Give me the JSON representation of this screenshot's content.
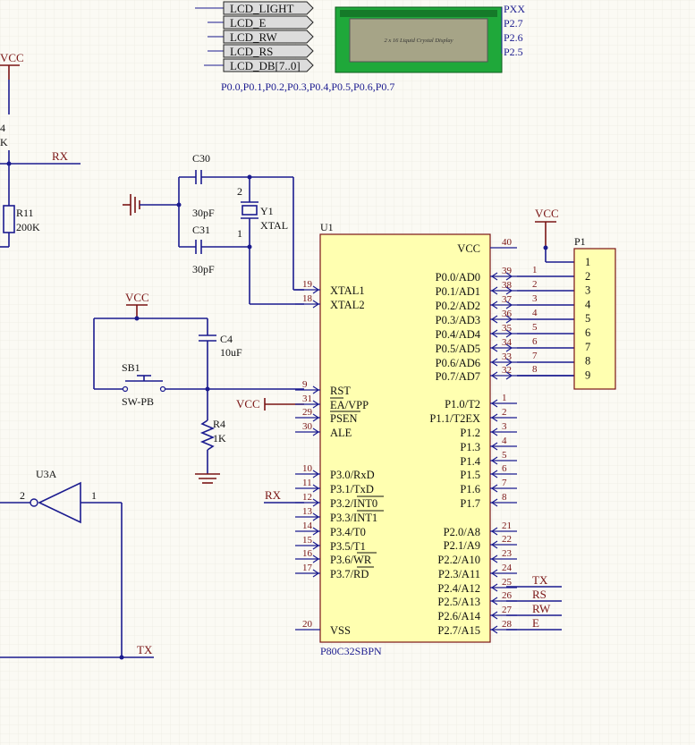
{
  "ports": [
    "LCD_LIGHT",
    "LCD_E",
    "LCD_RW",
    "LCD_RS",
    "LCD_DB[7..0]"
  ],
  "lcd": {
    "text": "2 x 16 Liquid Crystal Display",
    "pins": [
      "PXX",
      "P2.7",
      "P2.6",
      "P2.5"
    ],
    "bus_label": "P0.0,P0.1,P0.2,P0.3,P0.4,P0.5,P0.6,P0.7"
  },
  "power": {
    "vcc": "VCC"
  },
  "nets": {
    "rx": "RX",
    "tx": "TX",
    "rs": "RS",
    "rw": "RW",
    "e": "E"
  },
  "partial_resistor": {
    "line1": "4",
    "line2": "K"
  },
  "r11": {
    "ref": "R11",
    "value": "200K"
  },
  "c30": {
    "ref": "C30",
    "value": "30pF"
  },
  "c31": {
    "ref": "C31",
    "value": "30pF"
  },
  "y1": {
    "ref": "Y1",
    "value": "XTAL",
    "pin1": "1",
    "pin2": "2"
  },
  "c4": {
    "ref": "C4",
    "value": "10uF"
  },
  "sb1": {
    "ref": "SB1",
    "value": "SW-PB"
  },
  "r4": {
    "ref": "R4",
    "value": "1K"
  },
  "u3a": {
    "ref": "U3A",
    "pin_in": "1",
    "pin_out": "2"
  },
  "u1": {
    "ref": "U1",
    "part": "P80C32SBPN",
    "left_pins": [
      {
        "num": "19",
        "name": "XTAL1"
      },
      {
        "num": "18",
        "name": "XTAL2"
      },
      {
        "num": "9",
        "name": "RST"
      },
      {
        "num": "31",
        "name": "EA/VPP"
      },
      {
        "num": "29",
        "name": "PSEN"
      },
      {
        "num": "30",
        "name": "ALE"
      },
      {
        "num": "10",
        "name": "P3.0/RxD"
      },
      {
        "num": "11",
        "name": "P3.1/TxD"
      },
      {
        "num": "12",
        "name": "P3.2/INT0"
      },
      {
        "num": "13",
        "name": "P3.3/INT1"
      },
      {
        "num": "14",
        "name": "P3.4/T0"
      },
      {
        "num": "15",
        "name": "P3.5/T1"
      },
      {
        "num": "16",
        "name": "P3.6/WR"
      },
      {
        "num": "17",
        "name": "P3.7/RD"
      },
      {
        "num": "20",
        "name": "VSS"
      }
    ],
    "right_pins": [
      {
        "num": "40",
        "name": "VCC"
      },
      {
        "num": "39",
        "name": "P0.0/AD0"
      },
      {
        "num": "38",
        "name": "P0.1/AD1"
      },
      {
        "num": "37",
        "name": "P0.2/AD2"
      },
      {
        "num": "36",
        "name": "P0.3/AD3"
      },
      {
        "num": "35",
        "name": "P0.4/AD4"
      },
      {
        "num": "34",
        "name": "P0.5/AD5"
      },
      {
        "num": "33",
        "name": "P0.6/AD6"
      },
      {
        "num": "32",
        "name": "P0.7/AD7"
      },
      {
        "num": "1",
        "name": "P1.0/T2"
      },
      {
        "num": "2",
        "name": "P1.1/T2EX"
      },
      {
        "num": "3",
        "name": "P1.2"
      },
      {
        "num": "4",
        "name": "P1.3"
      },
      {
        "num": "5",
        "name": "P1.4"
      },
      {
        "num": "6",
        "name": "P1.5"
      },
      {
        "num": "7",
        "name": "P1.6"
      },
      {
        "num": "8",
        "name": "P1.7"
      },
      {
        "num": "21",
        "name": "P2.0/A8"
      },
      {
        "num": "22",
        "name": "P2.1/A9"
      },
      {
        "num": "23",
        "name": "P2.2/A10"
      },
      {
        "num": "24",
        "name": "P2.3/A11"
      },
      {
        "num": "25",
        "name": "P2.4/A12"
      },
      {
        "num": "26",
        "name": "P2.5/A13"
      },
      {
        "num": "27",
        "name": "P2.6/A14"
      },
      {
        "num": "28",
        "name": "P2.7/A15"
      }
    ]
  },
  "p1": {
    "ref": "P1",
    "pins": [
      "1",
      "2",
      "3",
      "4",
      "5",
      "6",
      "7",
      "8",
      "9"
    ],
    "bus_nums": [
      "1",
      "2",
      "3",
      "4",
      "5",
      "6",
      "7",
      "8"
    ]
  }
}
